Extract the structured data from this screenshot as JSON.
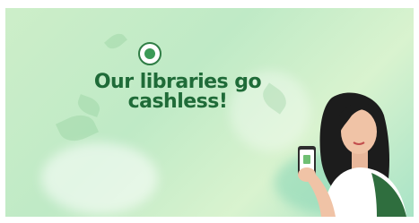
{
  "banner": {
    "logo_text": "",
    "headline": "Our libraries go cashless!",
    "subtext": "",
    "footer": "",
    "colors": {
      "headline": "#1f6b38",
      "background": "#c6ecc8",
      "accent": "#2f7d45"
    }
  },
  "illustration": {
    "subject": "woman-holding-phone",
    "icons": [
      "library-logo-icon",
      "phone-icon",
      "leaf-icon"
    ]
  }
}
